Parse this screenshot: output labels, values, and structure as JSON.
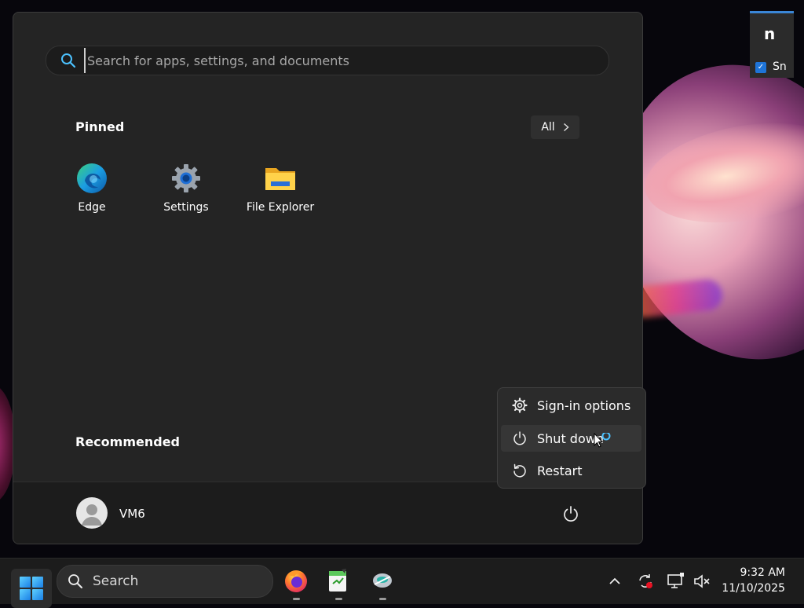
{
  "start_menu": {
    "search_placeholder": "Search for apps, settings, and documents",
    "pinned_title": "Pinned",
    "all_button": "All",
    "pinned_apps": [
      {
        "label": "Edge",
        "icon": "edge-icon"
      },
      {
        "label": "Settings",
        "icon": "settings-gear-icon"
      },
      {
        "label": "File Explorer",
        "icon": "folder-icon"
      }
    ],
    "recommended_title": "Recommended",
    "user": {
      "name": "VM6"
    }
  },
  "power_menu": {
    "items": [
      {
        "label": "Sign-in options",
        "icon": "gear-icon"
      },
      {
        "label": "Shut down",
        "icon": "power-icon",
        "highlighted": true
      },
      {
        "label": "Restart",
        "icon": "restart-icon"
      }
    ]
  },
  "taskbar": {
    "search_label": "Search",
    "apps": [
      "firefox-icon",
      "notepad-icon",
      "app-icon"
    ],
    "clock": {
      "time": "9:32 AM",
      "date": "11/10/2025"
    }
  },
  "side_widget": {
    "title": "n",
    "checkbox_label": "Sn"
  },
  "colors": {
    "menu_bg": "#242424",
    "accent": "#1e74d8",
    "taskbar_bg": "#1c1c1c"
  }
}
